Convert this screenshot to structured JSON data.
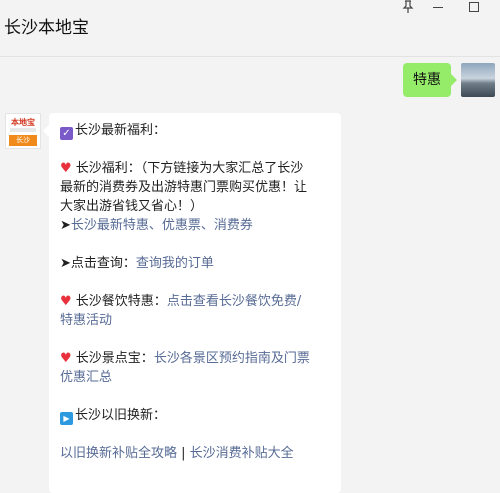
{
  "window": {
    "title": "长沙本地宝"
  },
  "conversation": {
    "sent_message": "特惠",
    "bot_avatar": {
      "logo_text": "本地宝",
      "tag": "长沙"
    }
  },
  "card": {
    "line1_text": "长沙最新福利：",
    "fuli_prefix": "长沙福利：（下方链接为大家汇总了长沙",
    "fuli_line2": "最新的消费券及出游特惠门票购买优惠！让",
    "fuli_line3": "大家出游省钱又省心！）",
    "arrow": "➤",
    "fuli_link": "长沙最新特惠、优惠票、消费券",
    "query_label": "点击查询：",
    "query_link": "查询我的订单",
    "food_label": "长沙餐饮特惠：",
    "food_link1": "点击查看长沙餐饮免费/",
    "food_link2": "特惠活动",
    "scenic_label": "长沙景点宝：",
    "scenic_link1": "长沙各景区预约指南及门票",
    "scenic_link2": "优惠汇总",
    "trade_label": "长沙以旧换新：",
    "trade_link1": "以旧换新补贴全攻略",
    "trade_sep": " | ",
    "trade_link2": "长沙消费补贴大全"
  },
  "icons": {
    "pin": "pin-icon",
    "minimize": "minimize-icon",
    "maximize": "maximize-icon",
    "check": "check-icon",
    "heart": "heart-icon",
    "play": "play-icon"
  }
}
